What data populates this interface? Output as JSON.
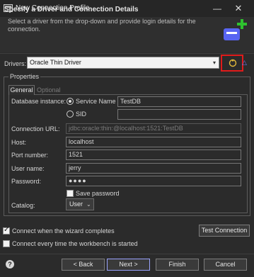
{
  "window": {
    "title": "New Connection Profile",
    "minimize_glyph": "—",
    "close_glyph": "✕"
  },
  "header": {
    "title": "Specify a Driver and Connection Details",
    "description": "Select a driver from the drop-down and provide login details for the connection."
  },
  "drivers": {
    "label": "Drivers:",
    "selected": "Oracle Thin Driver"
  },
  "properties": {
    "group_label": "Properties",
    "tabs": [
      "General",
      "Optional"
    ],
    "database_instance_label": "Database instance:",
    "service_name_label": "Service Name",
    "service_name_value": "TestDB",
    "sid_label": "SID",
    "sid_value": "",
    "connection_url_label": "Connection URL:",
    "connection_url_value": "jdbc:oracle:thin:@localhost:1521:TestDB",
    "host_label": "Host:",
    "host_value": "localhost",
    "port_label": "Port number:",
    "port_value": "1521",
    "username_label": "User name:",
    "username_value": "jerry",
    "password_label": "Password:",
    "password_value": "●●●●",
    "save_password_label": "Save password",
    "save_password_checked": false,
    "catalog_label": "Catalog:",
    "catalog_value": "User"
  },
  "options": {
    "connect_on_complete_label": "Connect when the wizard completes",
    "connect_on_complete_checked": true,
    "connect_every_start_label": "Connect every time the workbench is started",
    "connect_every_start_checked": false,
    "test_connection_label": "Test Connection"
  },
  "footer": {
    "help_glyph": "?",
    "back_label": "< Back",
    "next_label": "Next >",
    "finish_label": "Finish",
    "cancel_label": "Cancel"
  },
  "colors": {
    "highlight_box": "#e01b1b",
    "plus_accent": "#2ec22e",
    "wizard_blue": "#5865f2"
  }
}
